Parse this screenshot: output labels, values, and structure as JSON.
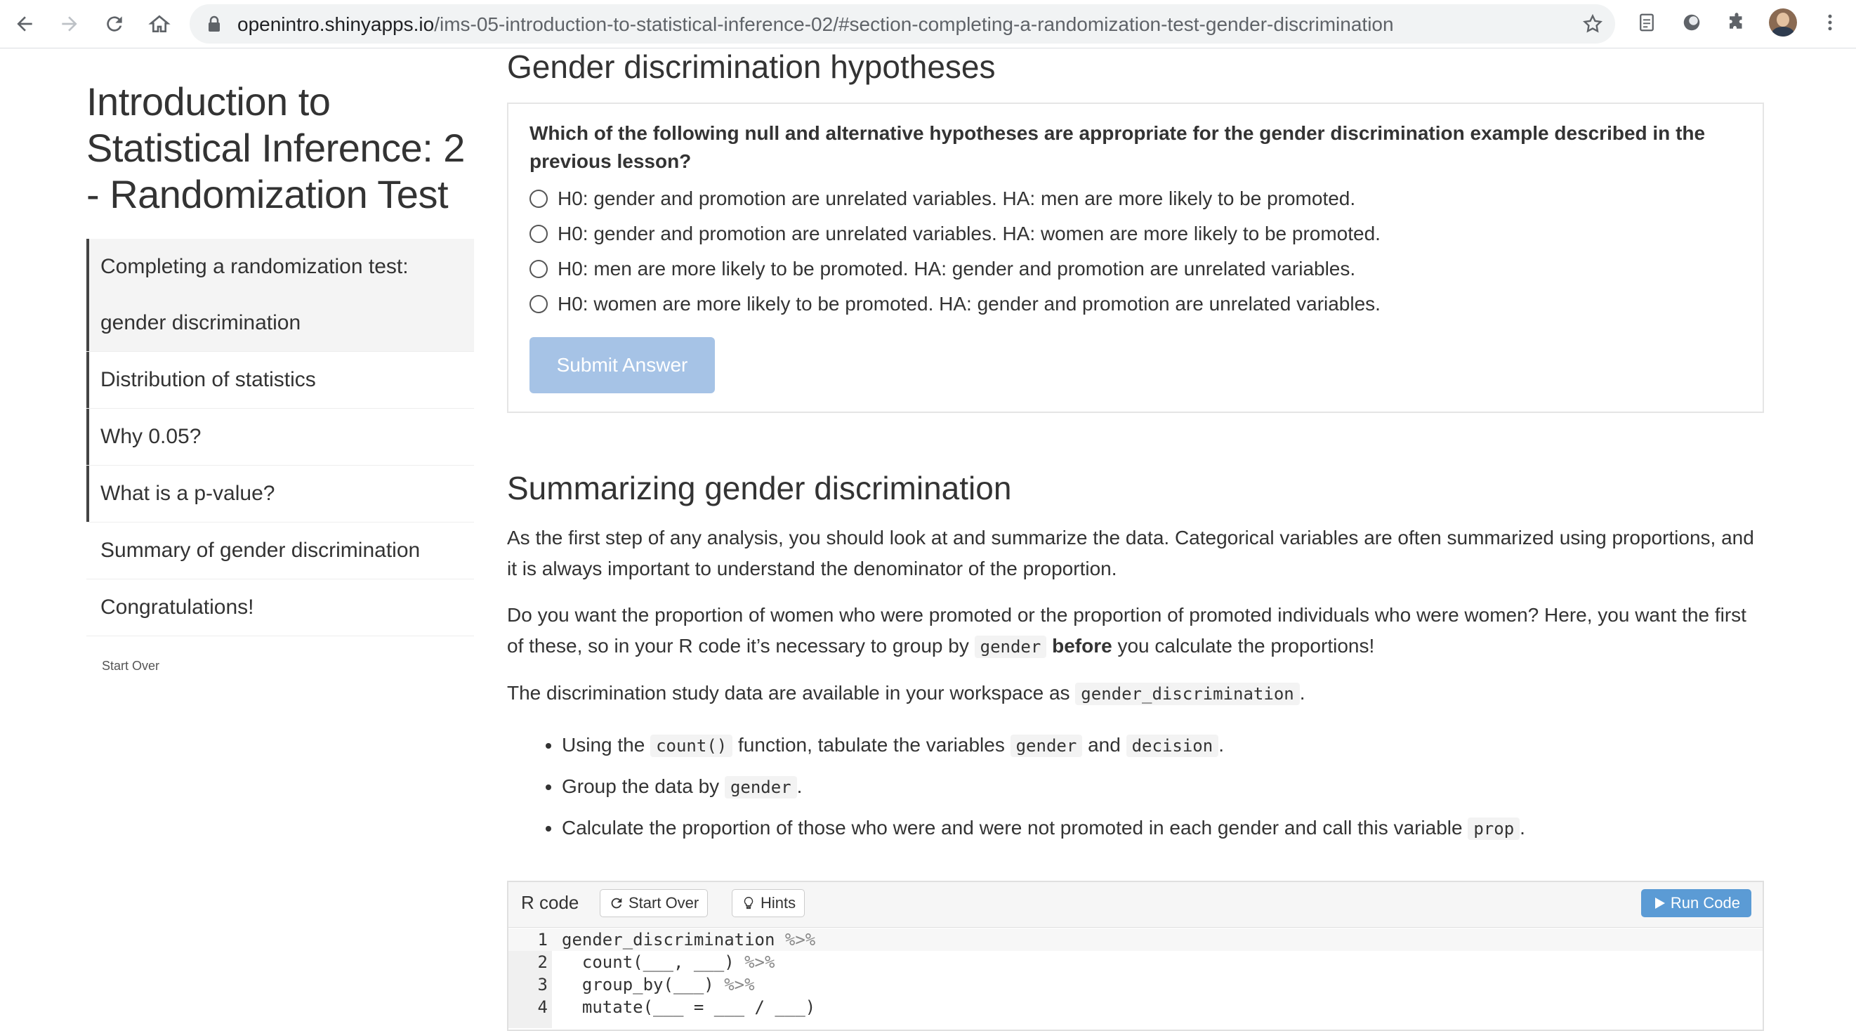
{
  "browser": {
    "url_host": "openintro.shinyapps.io",
    "url_path": "/ims-05-introduction-to-statistical-inference-02/#section-completing-a-randomization-test-gender-discrimination"
  },
  "sidebar": {
    "title": "Introduction to Statistical Inference: 2 - Randomization Test",
    "items": [
      {
        "line1": "Completing a randomization test:",
        "line2": "gender discrimination"
      },
      {
        "label": "Distribution of statistics"
      },
      {
        "label": "Why 0.05?"
      },
      {
        "label": "What is a p-value?"
      },
      {
        "label": "Summary of gender discrimination"
      },
      {
        "label": "Congratulations!"
      }
    ],
    "start_over": "Start Over"
  },
  "quiz": {
    "heading": "Gender discrimination hypotheses",
    "question": "Which of the following null and alternative hypotheses are appropriate for the gender discrimination example described in the previous lesson?",
    "options": [
      "H0: gender and promotion are unrelated variables. HA: men are more likely to be promoted.",
      "H0: gender and promotion are unrelated variables. HA: women are more likely to be promoted.",
      "H0: men are more likely to be promoted. HA: gender and promotion are unrelated variables.",
      "H0: women are more likely to be promoted. HA: gender and promotion are unrelated variables."
    ],
    "submit_label": "Submit Answer"
  },
  "summary": {
    "heading": "Summarizing gender discrimination",
    "p1": "As the first step of any analysis, you should look at and summarize the data. Categorical variables are often summarized using proportions, and it is always important to understand the denominator of the proportion.",
    "p2_a": "Do you want the proportion of women who were promoted or the proportion of promoted individuals who were women? Here, you want the first of these, so in your R code it’s necessary to group by ",
    "p2_code": "gender",
    "p2_bold": "before",
    "p2_b": " you calculate the proportions!",
    "p3_a": "The discrimination study data are available in your workspace as ",
    "p3_code": "gender_discrimination",
    "p3_b": ".",
    "b1_a": "Using the ",
    "b1_code1": "count()",
    "b1_b": " function, tabulate the variables ",
    "b1_code2": "gender",
    "b1_c": " and ",
    "b1_code3": "decision",
    "b1_d": ".",
    "b2_a": "Group the data by ",
    "b2_code": "gender",
    "b2_b": ".",
    "b3_a": "Calculate the proportion of those who were and were not promoted in each gender and call this variable ",
    "b3_code": "prop",
    "b3_b": "."
  },
  "code_widget": {
    "label": "R code",
    "start_over_label": "Start Over",
    "hints_label": "Hints",
    "run_label": "Run Code",
    "lines": [
      {
        "num": "1",
        "code": "gender_discrimination",
        "pipe": " %>%"
      },
      {
        "num": "2",
        "code": "  count(___, ___)",
        "pipe": " %>%"
      },
      {
        "num": "3",
        "code": "  group_by(___)",
        "pipe": " %>%"
      },
      {
        "num": "4",
        "code": "  mutate(___ = ___ / ___)",
        "pipe": ""
      }
    ]
  }
}
